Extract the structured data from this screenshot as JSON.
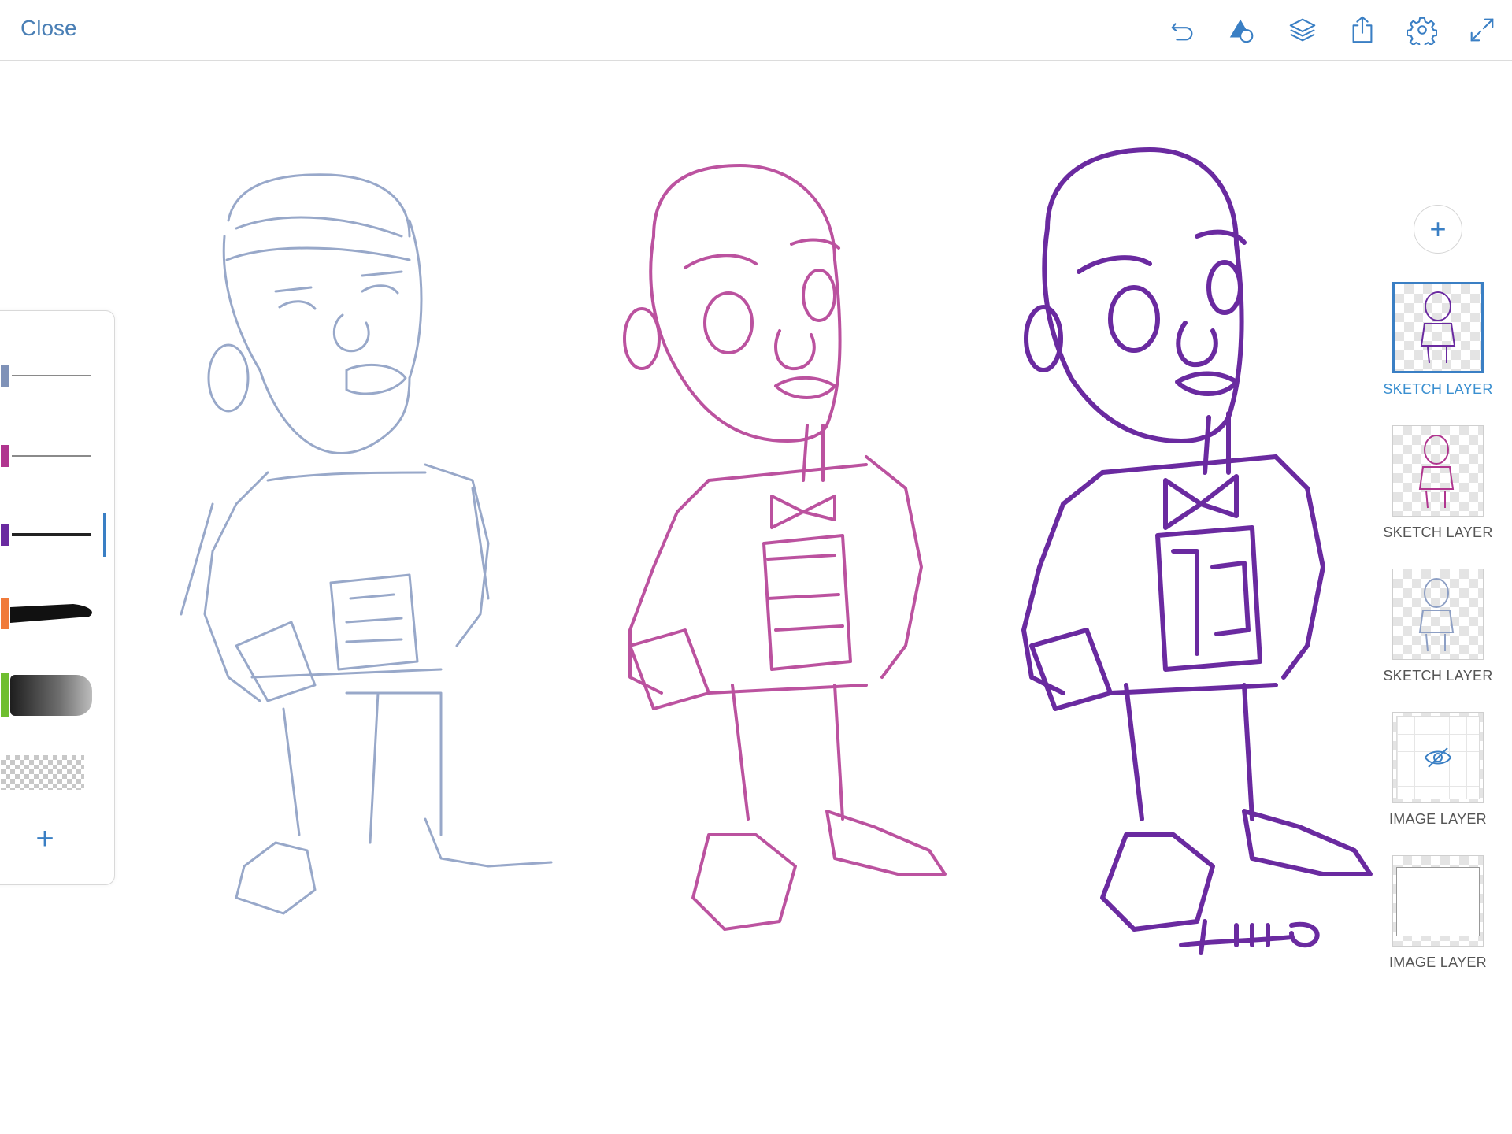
{
  "topbar": {
    "close_label": "Close",
    "icons": [
      "undo-icon",
      "shapes-icon",
      "layers-icon",
      "share-icon",
      "settings-icon",
      "fullscreen-icon"
    ]
  },
  "brush_panel": {
    "brushes": [
      {
        "name": "pencil-blue",
        "color": "#7f92b8"
      },
      {
        "name": "pencil-magenta",
        "color": "#b0358f"
      },
      {
        "name": "pen-purple",
        "color": "#6a2aa0",
        "selected": true
      },
      {
        "name": "ink-brush",
        "color": "#f07a3a"
      },
      {
        "name": "wash-brush",
        "color": "#6fbe2f"
      },
      {
        "name": "eraser",
        "color": "#cccccc"
      }
    ],
    "add_label": "+"
  },
  "layers": {
    "add_label": "+",
    "items": [
      {
        "label": "SKETCH LAYER",
        "selected": true,
        "stroke": "#6a2aa0"
      },
      {
        "label": "SKETCH LAYER",
        "selected": false,
        "stroke": "#b0358f"
      },
      {
        "label": "SKETCH LAYER",
        "selected": false,
        "stroke": "#8d9fc4"
      },
      {
        "label": "IMAGE LAYER",
        "selected": false,
        "hidden": true
      },
      {
        "label": "IMAGE LAYER",
        "selected": false
      }
    ]
  },
  "colors": {
    "accent": "#3a7fc4",
    "sketch_blue": "#8d9fc4",
    "sketch_magenta": "#b0358f",
    "ink_purple": "#6a2aa0"
  }
}
